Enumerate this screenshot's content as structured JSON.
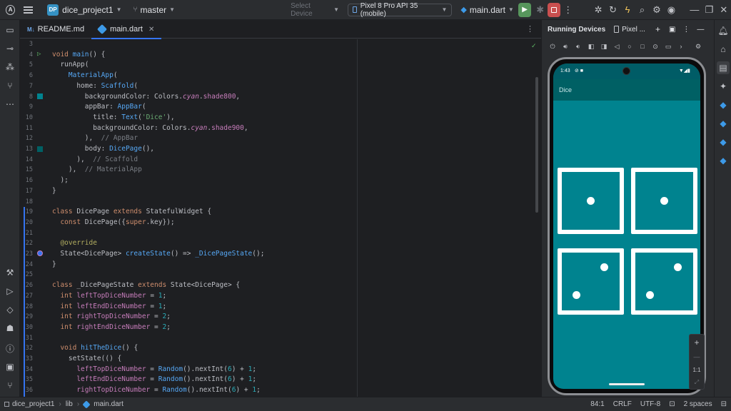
{
  "titlebar": {
    "project_badge": "DP",
    "project_name": "dice_project1",
    "branch": "master",
    "select_device": "Select Device",
    "device": "Pixel 8 Pro API 35 (mobile)",
    "run_config": "main.dart"
  },
  "tabs": [
    {
      "icon": "M↓",
      "label": "README.md"
    },
    {
      "label": "main.dart"
    }
  ],
  "code": {
    "line_numbers": [
      "3",
      "4",
      "5",
      "6",
      "7",
      "8",
      "9",
      "10",
      "11",
      "12",
      "13",
      "14",
      "15",
      "16",
      "17",
      "18",
      "19",
      "20",
      "21",
      "22",
      "23",
      "24",
      "25",
      "26",
      "27",
      "28",
      "29",
      "30",
      "31",
      "32",
      "33",
      "34",
      "35",
      "36"
    ]
  },
  "device_panel": {
    "title": "Running Devices",
    "tab": "Pixel ...",
    "zoom_reset": "1:1"
  },
  "phone": {
    "time": "1:43",
    "app_title": "Dice"
  },
  "statusbar": {
    "crumb_project": "dice_project1",
    "crumb_folder": "lib",
    "crumb_file": "main.dart",
    "position": "84:1",
    "line_sep": "CRLF",
    "encoding": "UTF-8",
    "indent": "2 spaces"
  },
  "colors": {
    "screen_bg": "#00838f",
    "appbar_bg": "#006064",
    "accent": "#3574f0"
  }
}
